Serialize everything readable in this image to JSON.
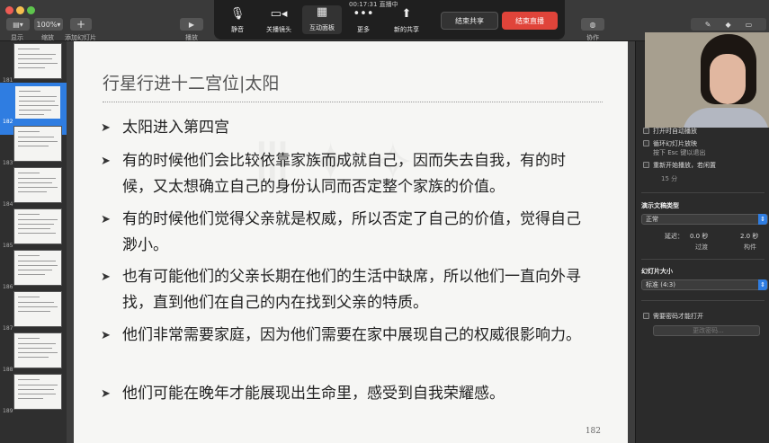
{
  "toolbar": {
    "view_label": "显示",
    "zoom_value": "100%",
    "zoom_label": "缩放",
    "add_slide_label": "添加幻灯片",
    "play_label": "播放",
    "collaborate_label": "协作"
  },
  "zoom_bar": {
    "mute_label": "静音",
    "stop_video_label": "关播镜头",
    "whiteboard_label": "互动面板",
    "more_label": "更多",
    "new_share_label": "新的共享",
    "end_share_label": "结束共享",
    "end_live_label": "结束直播",
    "timer_text": "00:17:31 直播中",
    "end_live_color": "#e0443a"
  },
  "sidebar": {
    "slides": [
      {
        "num": "181",
        "selected": false
      },
      {
        "num": "182",
        "selected": true
      },
      {
        "num": "183",
        "selected": false
      },
      {
        "num": "184",
        "selected": false
      },
      {
        "num": "185",
        "selected": false
      },
      {
        "num": "186",
        "selected": false
      },
      {
        "num": "187",
        "selected": false
      },
      {
        "num": "188",
        "selected": false
      },
      {
        "num": "189",
        "selected": false
      }
    ]
  },
  "slide": {
    "title": "行星行进十二宫位|太阳",
    "bullets": [
      "太阳进入第四宫",
      "有的时候他们会比较依靠家族而成就自己，因而失去自我，有的时候，又太想确立自己的身份认同而否定整个家族的价值。",
      "有的时候他们觉得父亲就是权威，所以否定了自己的价值，觉得自己渺小。",
      "也有可能他们的父亲长期在他们的生活中缺席，所以他们一直向外寻找，直到他们在自己的内在找到父亲的特质。",
      "他们非常需要家庭，因为他们需要在家中展现自己的权威很影响力。",
      "他们可能在晚年才能展现出生命里，感受到自我荣耀感。"
    ],
    "page_number": "182"
  },
  "inspector": {
    "auto_open_label": "打开时自动播放",
    "loop_label": "循环幻灯片放映",
    "loop_hint": "按下 Esc 键以退出",
    "restart_label": "重新开始播放，若闲置",
    "idle_minutes": "15 分",
    "doc_type_heading": "演示文稿类型",
    "doc_type_value": "正常",
    "delay_label": "延迟：",
    "transition_value": "0.0 秒",
    "transition_label": "过渡",
    "build_value": "2.0 秒",
    "build_label": "构件",
    "slide_size_heading": "幻灯片大小",
    "slide_size_value": "标准 (4:3)",
    "password_label": "需要密码才能打开",
    "change_password_label": "更改密码..."
  },
  "colors": {
    "accent": "#2f7de1",
    "slide_bg": "#f6f6f4",
    "toolbar_bg": "#3a3a3a"
  }
}
